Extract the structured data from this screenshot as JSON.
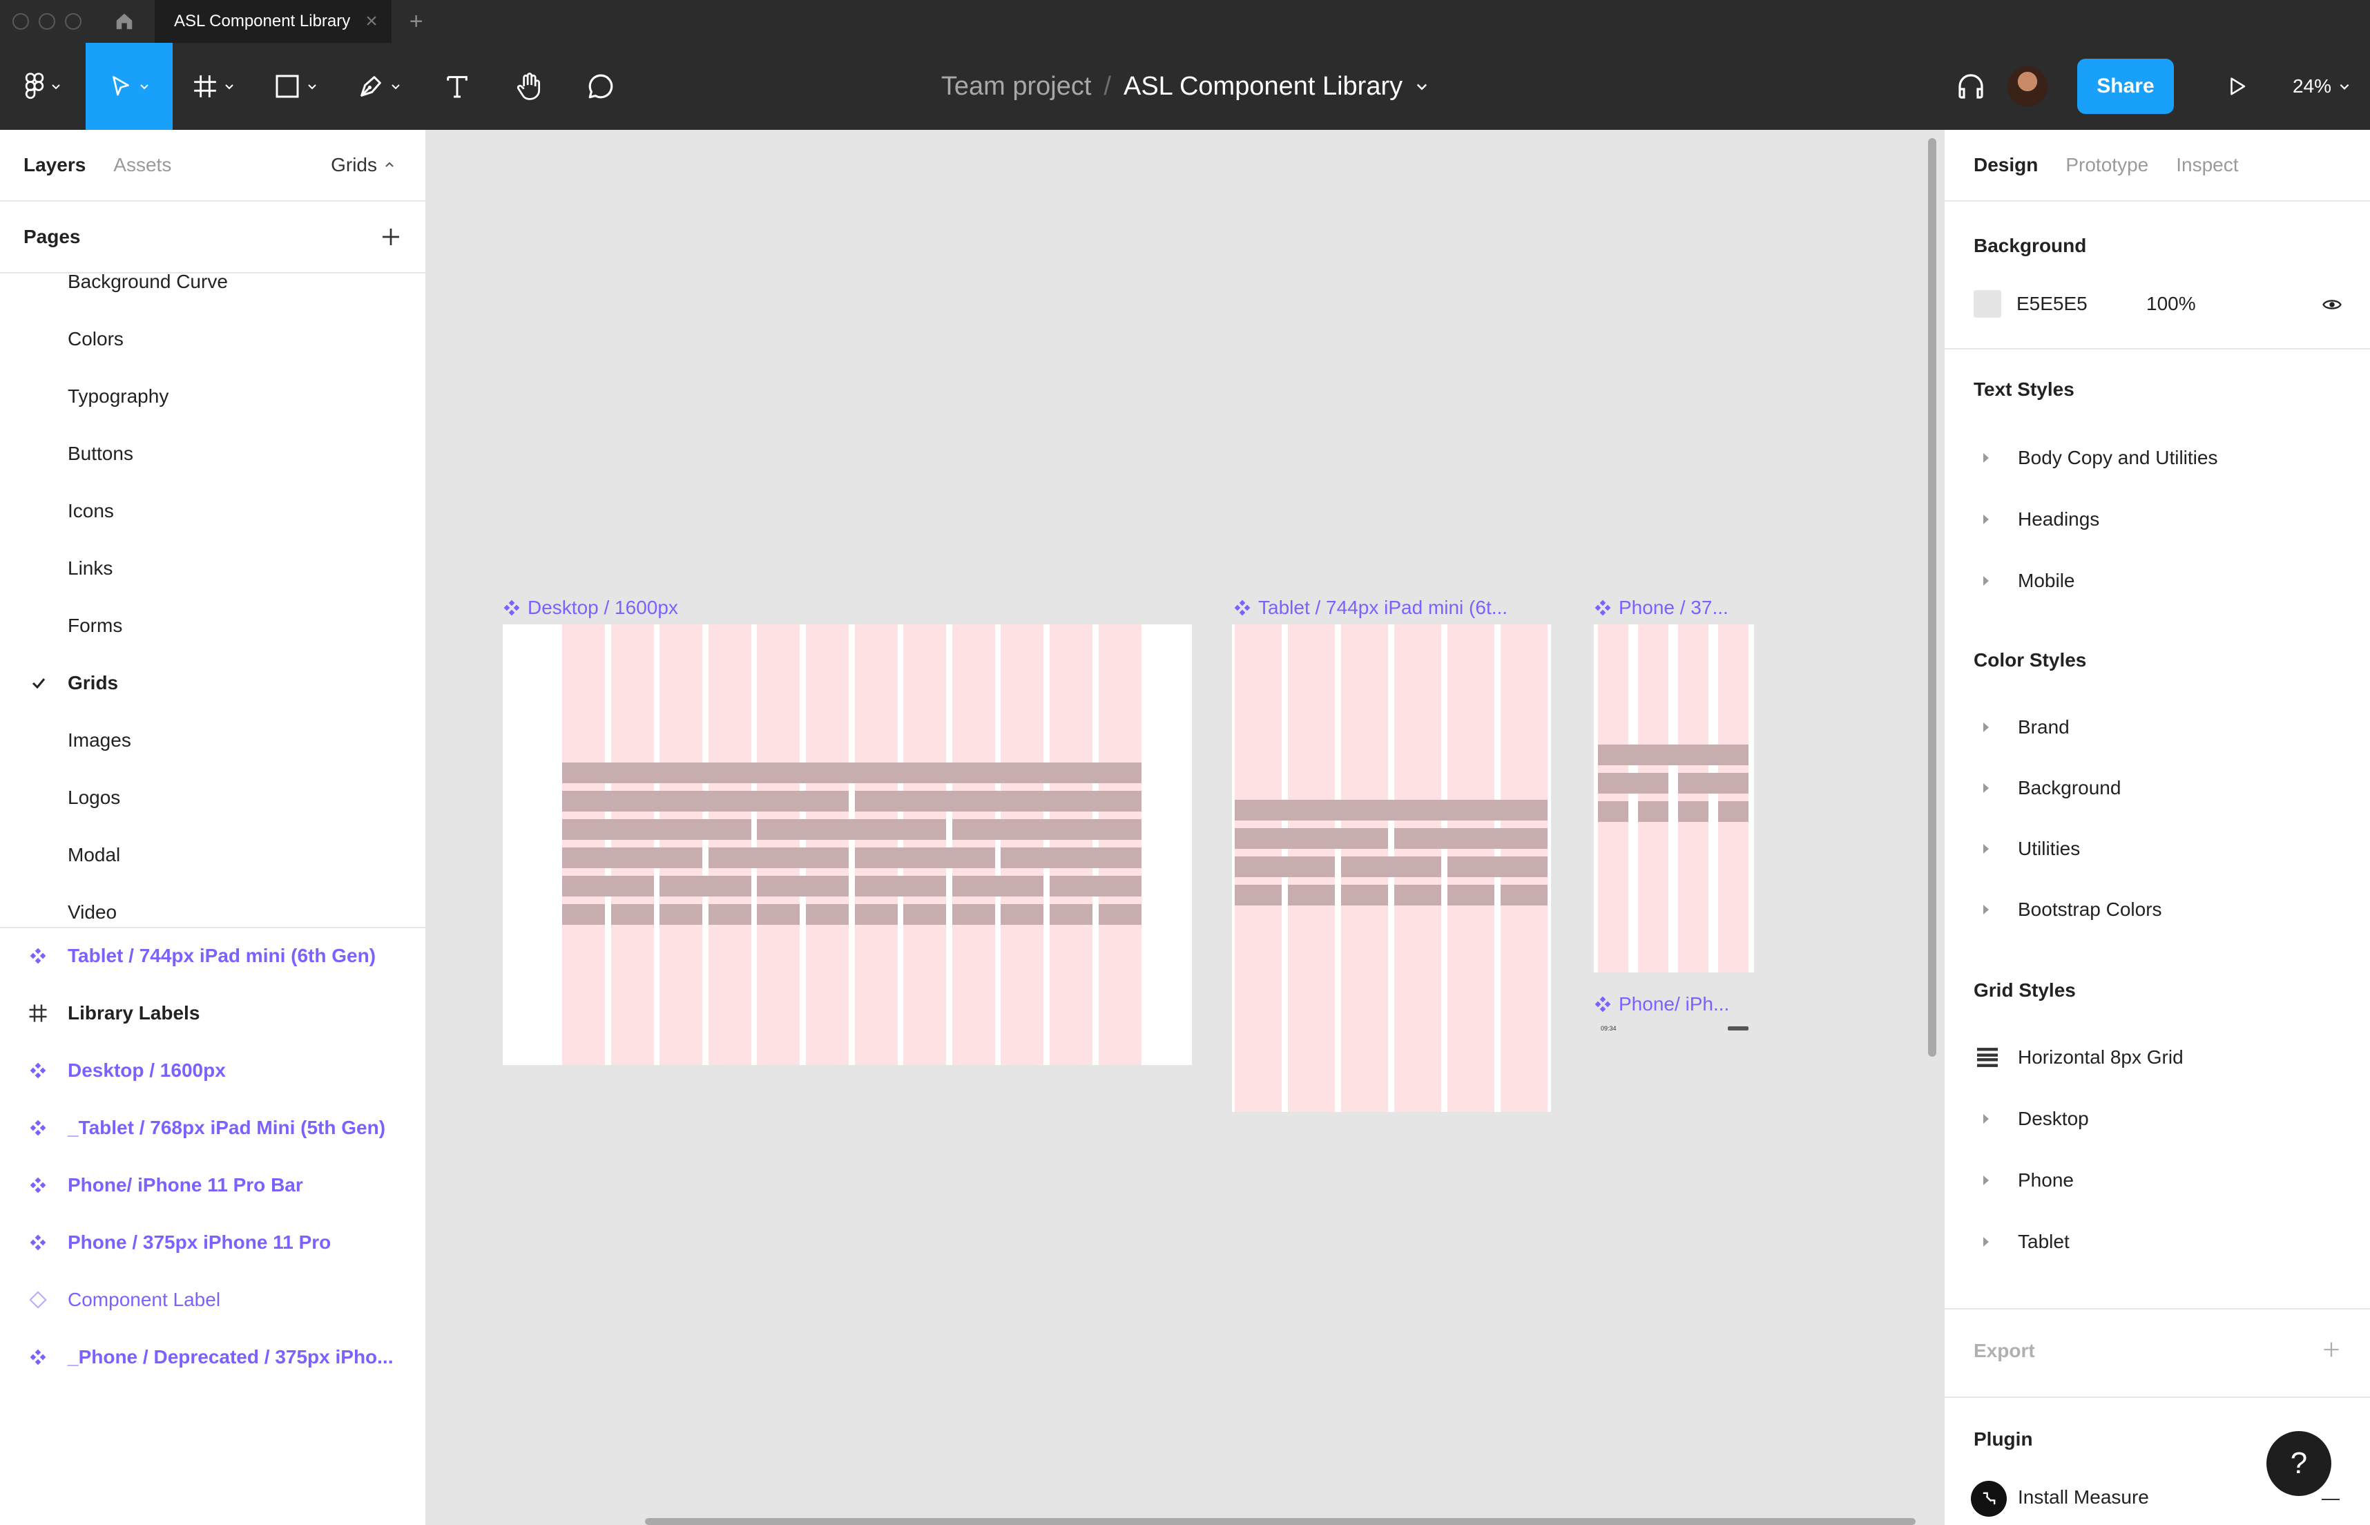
{
  "titlebar": {
    "tab_label": "ASL Component Library",
    "tab_close": "×",
    "new_tab": "+"
  },
  "toolbar": {
    "project": "Team project",
    "separator": "/",
    "file_name": "ASL Component Library",
    "share_label": "Share",
    "zoom": "24%"
  },
  "left_panel": {
    "tabs": {
      "layers": "Layers",
      "assets": "Assets"
    },
    "current_page_selector": "Grids",
    "pages_label": "Pages",
    "pages": [
      {
        "label": "Background Curve"
      },
      {
        "label": "Colors"
      },
      {
        "label": "Typography"
      },
      {
        "label": "Buttons"
      },
      {
        "label": "Icons"
      },
      {
        "label": "Links"
      },
      {
        "label": "Forms"
      },
      {
        "label": "Grids",
        "current": true
      },
      {
        "label": "Images"
      },
      {
        "label": "Logos"
      },
      {
        "label": "Modal"
      },
      {
        "label": "Video"
      }
    ],
    "layers": [
      {
        "label": "Tablet / 744px iPad mini (6th Gen)",
        "kind": "component"
      },
      {
        "label": "Library Labels",
        "kind": "frame"
      },
      {
        "label": "Desktop / 1600px",
        "kind": "component"
      },
      {
        "label": "_Tablet / 768px iPad Mini (5th Gen)",
        "kind": "component"
      },
      {
        "label": "Phone/ iPhone 11 Pro Bar",
        "kind": "component"
      },
      {
        "label": "Phone / 375px iPhone 11 Pro",
        "kind": "component"
      },
      {
        "label": "Component Label",
        "kind": "instance"
      },
      {
        "label": "_Phone / Deprecated / 375px iPho...",
        "kind": "component"
      }
    ]
  },
  "canvas": {
    "frames": {
      "desktop": "Desktop / 1600px",
      "tablet": "Tablet / 744px iPad mini (6t...",
      "phone": "Phone / 37...",
      "phone_bar": "Phone/ iPh..."
    },
    "phone_time": "09:34"
  },
  "right_panel": {
    "tabs": {
      "design": "Design",
      "prototype": "Prototype",
      "inspect": "Inspect"
    },
    "background": {
      "title": "Background",
      "hex": "E5E5E5",
      "opacity": "100%",
      "swatch_color": "#E5E5E5"
    },
    "text_styles": {
      "title": "Text Styles",
      "items": [
        "Body Copy and Utilities",
        "Headings",
        "Mobile"
      ]
    },
    "color_styles": {
      "title": "Color Styles",
      "items": [
        "Brand",
        "Background",
        "Utilities",
        "Bootstrap Colors"
      ]
    },
    "grid_styles": {
      "title": "Grid Styles",
      "items": [
        "Horizontal 8px Grid",
        "Desktop",
        "Phone",
        "Tablet"
      ]
    },
    "export_title": "Export",
    "plugin_title": "Plugin",
    "plugin_item": "Install Measure",
    "help_label": "?"
  },
  "colors": {
    "accent": "#18A0FB",
    "component": "#7B61FF",
    "toolbar_bg": "#2C2C2C",
    "canvas_bg": "#E5E5E5",
    "grid_column": "#FDE1E3",
    "grid_block": "#C8ADAE"
  },
  "icons": {
    "toolbar": [
      "figma-menu-icon",
      "move-tool-icon",
      "frame-tool-icon",
      "shape-tool-icon",
      "pen-tool-icon",
      "text-tool-icon",
      "hand-tool-icon",
      "comment-tool-icon",
      "audio-headphones-icon",
      "play-icon"
    ],
    "layers": [
      "component-icon",
      "frame-grid-icon",
      "instance-icon"
    ]
  }
}
